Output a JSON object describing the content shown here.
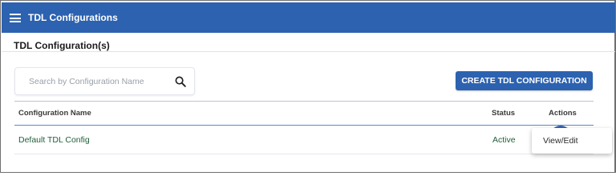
{
  "app": {
    "title": "TDL Configurations",
    "menu_icon": "hamburger-menu-icon",
    "brand_color": "#2c62b0"
  },
  "page": {
    "title": "TDL Configuration(s)"
  },
  "search": {
    "placeholder": "Search by Configuration Name",
    "value": "",
    "icon": "search-icon"
  },
  "toolbar": {
    "create_label": "CREATE TDL CONFIGURATION"
  },
  "table": {
    "columns": [
      "Configuration Name",
      "Status",
      "Actions"
    ],
    "rows": [
      {
        "name": "Default TDL Config",
        "status": "Active"
      }
    ]
  },
  "actions_menu": {
    "items": [
      "View/Edit"
    ]
  },
  "colors": {
    "status_text": "#1f5e3a",
    "header_rule": "#5f87c4"
  }
}
